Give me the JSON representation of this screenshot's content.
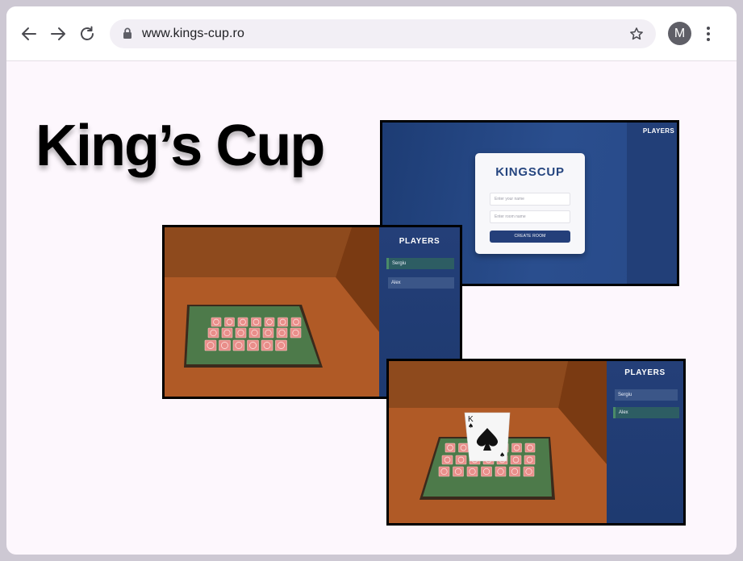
{
  "browser": {
    "url": "www.kings-cup.ro",
    "profile_initial": "M"
  },
  "page": {
    "headline": "King’s Cup"
  },
  "lobby": {
    "sidebar_title": "PLAYERS",
    "brand": "KINGSCUP",
    "name_placeholder": "Enter your name",
    "room_placeholder": "Enter room name",
    "create_button": "CREATE ROOM"
  },
  "game1": {
    "sidebar_title": "PLAYERS",
    "players": [
      "Sergiu",
      "Alex"
    ],
    "active_player": "Sergiu"
  },
  "game2": {
    "sidebar_title": "PLAYERS",
    "players": [
      "Sergiu",
      "Alex"
    ],
    "active_player": "Alex",
    "drawn_card": {
      "rank": "K",
      "suit": "♠"
    }
  },
  "colors": {
    "accent_blue": "#243f7a",
    "table_green": "#4d7a4a",
    "card_pink": "#e98e8a",
    "floor_orange": "#ad5a2a",
    "active_row": "#2d5d63"
  }
}
